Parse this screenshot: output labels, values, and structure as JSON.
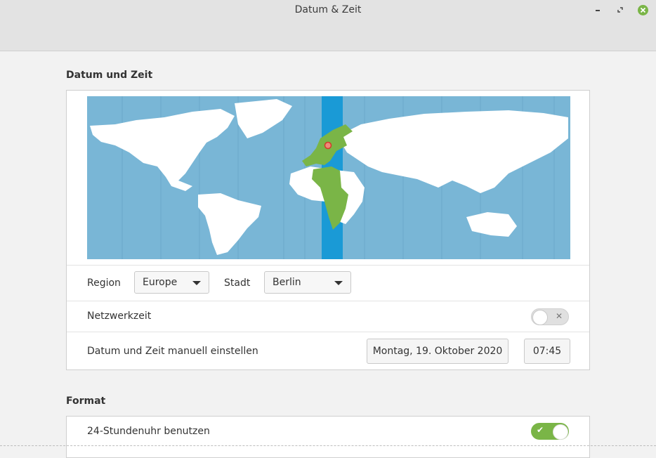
{
  "window": {
    "title": "Datum & Zeit"
  },
  "section_datetime": {
    "title": "Datum und Zeit",
    "map": {
      "selected_city": "Berlin",
      "highlight_color": "#7ab547",
      "zone_band_color": "#1a9ad6",
      "ocean_color": "#79b6d6"
    },
    "region_label": "Region",
    "region_value": "Europe",
    "city_label": "Stadt",
    "city_value": "Berlin",
    "network_time_label": "Netzwerkzeit",
    "network_time_enabled": false,
    "manual_label": "Datum und Zeit manuell einstellen",
    "date_button": "Montag, 19. Oktober 2020",
    "time_button": "07:45"
  },
  "section_format": {
    "title": "Format",
    "use_24h_label": "24-Stundenuhr benutzen",
    "use_24h_enabled": true
  },
  "colors": {
    "accent": "#7ab547"
  }
}
